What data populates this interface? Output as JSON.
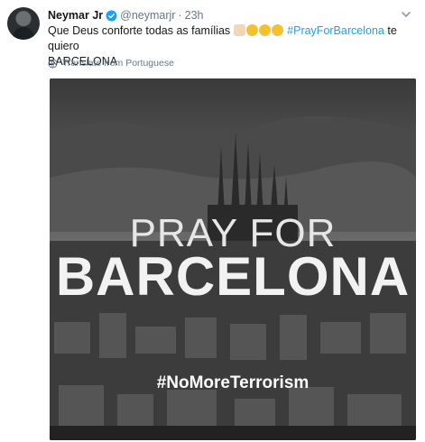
{
  "tweet": {
    "name": "Neymar Jr",
    "handle": "@neymarjr",
    "separator": "·",
    "time": "23h",
    "text_before": "Que Deus conforte todas as famílias",
    "hashtag": "#PrayForBarcelona",
    "text_after": "te quiero",
    "text_line2": "BARCELONA",
    "translate": "Translate from Portuguese"
  },
  "image": {
    "line1": "PRAY FOR",
    "line2": "BARCELONA",
    "line3": "#NoMoreTerrorism"
  }
}
